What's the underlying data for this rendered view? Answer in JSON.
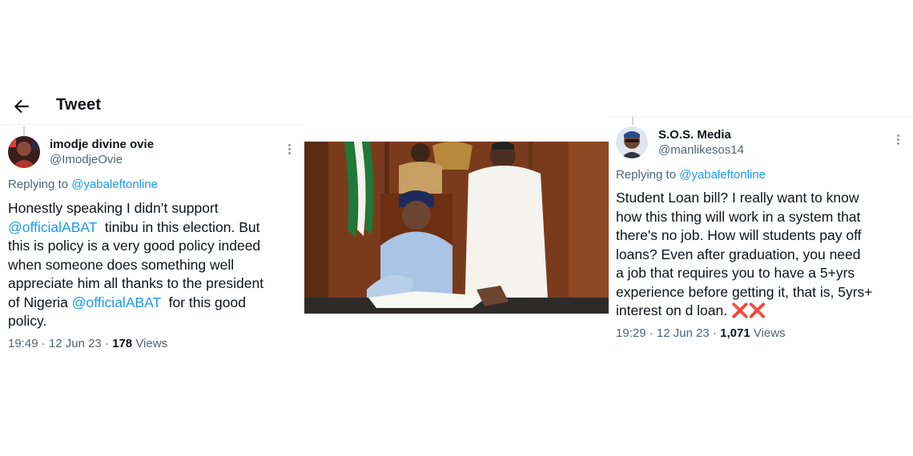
{
  "left_tweet": {
    "header_title": "Tweet",
    "author_name": "imodje divine ovie",
    "author_handle": "@ImodjeOvie",
    "replying_prefix": "Replying to",
    "replying_handle": "@yabaleftonline",
    "lines": [
      {
        "pre": "Honestly speaking I didn’t support",
        "mention": "",
        "post": ""
      },
      {
        "pre": "",
        "mention": "@officialABAT",
        "post": "  tinibu in this election. But"
      },
      {
        "pre": "this is policy is a very good policy indeed",
        "mention": "",
        "post": ""
      },
      {
        "pre": "when someone does something well",
        "mention": "",
        "post": ""
      },
      {
        "pre": "appreciate him all thanks to the president",
        "mention": "",
        "post": ""
      },
      {
        "pre": "of Nigeria ",
        "mention": "@officialABAT",
        "post": "  for this good"
      },
      {
        "pre": "policy.",
        "mention": "",
        "post": ""
      }
    ],
    "time": "19:49",
    "date": "12 Jun 23",
    "views": "178",
    "views_label": "Views"
  },
  "right_tweet": {
    "author_name": "S.O.S. Media",
    "author_handle": "@manlikesos14",
    "replying_prefix": "Replying to",
    "replying_handle": "@yabaleftonline",
    "lines": [
      "Student Loan bill? I really want to know",
      "how this thing will work in a system that",
      "there's no job. How will students pay off",
      "loans? Even after graduation, you need",
      "a job that requires you to have a 5+yrs",
      "experience before getting it, that is, 5yrs+",
      "interest on d loan. "
    ],
    "emoji_marks": "❌❌",
    "time": "19:29",
    "date": "12 Jun 23",
    "views": "1,071",
    "views_label": "Views"
  },
  "icons": {
    "back": "back-arrow-icon",
    "more": "more-dots-icon",
    "cross_mark": "cross-mark-emoji"
  },
  "colors": {
    "link": "#1d9bf0",
    "secondary_text": "#536471",
    "primary_text": "#0f1419",
    "divider": "#eef1f3"
  }
}
